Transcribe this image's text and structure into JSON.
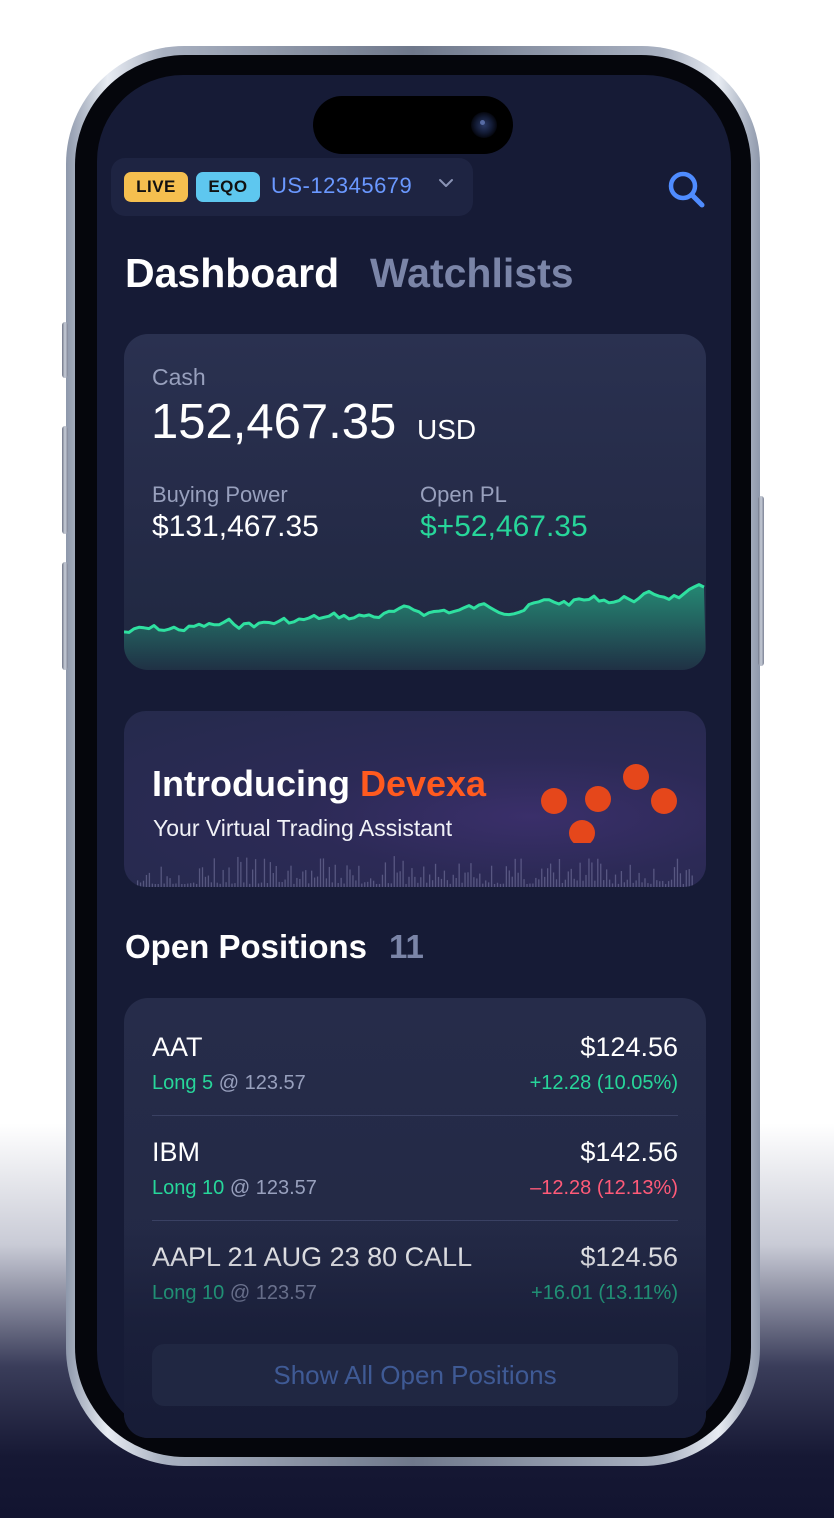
{
  "account": {
    "mode_badge": "LIVE",
    "type_badge": "EQO",
    "account_id": "US-12345679",
    "dropdown_glyph": "⌄"
  },
  "tabs": [
    {
      "label": "Dashboard",
      "active": true
    },
    {
      "label": "Watchlists",
      "active": false
    }
  ],
  "cash_card": {
    "cash_label": "Cash",
    "cash_value": "152,467.35",
    "cash_currency": "USD",
    "buying_power_label": "Buying Power",
    "buying_power_value": "$131,467.35",
    "open_pl_label": "Open PL",
    "open_pl_value": "$+52,467.35"
  },
  "promo": {
    "title_prefix": "Introducing ",
    "title_brand": "Devexa",
    "subtitle": "Your Virtual Trading Assistant"
  },
  "open_positions": {
    "title": "Open Positions",
    "count": "11",
    "rows": [
      {
        "symbol": "AAT",
        "side_qty": "Long 5",
        "entry": "@ 123.57",
        "price": "$124.56",
        "change": "+12.28 (10.05%)",
        "direction": "up"
      },
      {
        "symbol": "IBM",
        "side_qty": "Long 10",
        "entry": "@ 123.57",
        "price": "$142.56",
        "change": "–12.28 (12.13%)",
        "direction": "down"
      },
      {
        "symbol": "AAPL 21 AUG 23 80 CALL",
        "side_qty": "Long 10",
        "entry": "@ 123.57",
        "price": "$124.56",
        "change": "+16.01 (13.11%)",
        "direction": "up"
      }
    ],
    "show_all_label": "Show All Open Positions"
  },
  "colors": {
    "accent_blue": "#6a98ff",
    "positive": "#27d69a",
    "negative": "#ff5a78",
    "brand_orange": "#ff5a1f",
    "live_badge": "#f5bf4f",
    "eqo_badge": "#5ec7ef"
  },
  "icons": {
    "search": "search-icon",
    "chevron": "chevron-down-icon",
    "logo": "devexa-logo-icon"
  }
}
